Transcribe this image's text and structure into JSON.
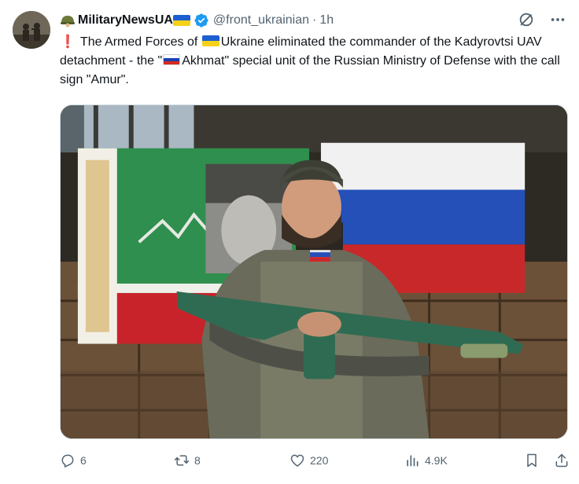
{
  "tweet": {
    "author_name": "MilitaryNewsUA",
    "handle": "@front_ukrainian",
    "separator": "·",
    "time": "1h",
    "text_excl": "❗",
    "text_part1": "The Armed Forces of ",
    "text_part2": "Ukraine eliminated the commander of the Kadyrovtsi UAV detachment - the \"",
    "text_part3": "Akhmat\" special unit of the Russian Ministry of Defense with the call sign \"Amur\"."
  },
  "stats": {
    "replies": "6",
    "reposts": "8",
    "likes": "220",
    "views": "4.9K"
  },
  "colors": {
    "text": "#0f1419",
    "muted": "#536471",
    "verified": "#1d9bf0",
    "border": "#cfd9de"
  },
  "icons": [
    "helmet-icon",
    "verified-badge-icon",
    "grok-icon",
    "more-icon",
    "reply-icon",
    "retweet-icon",
    "like-icon",
    "views-icon",
    "bookmark-icon",
    "share-icon"
  ]
}
